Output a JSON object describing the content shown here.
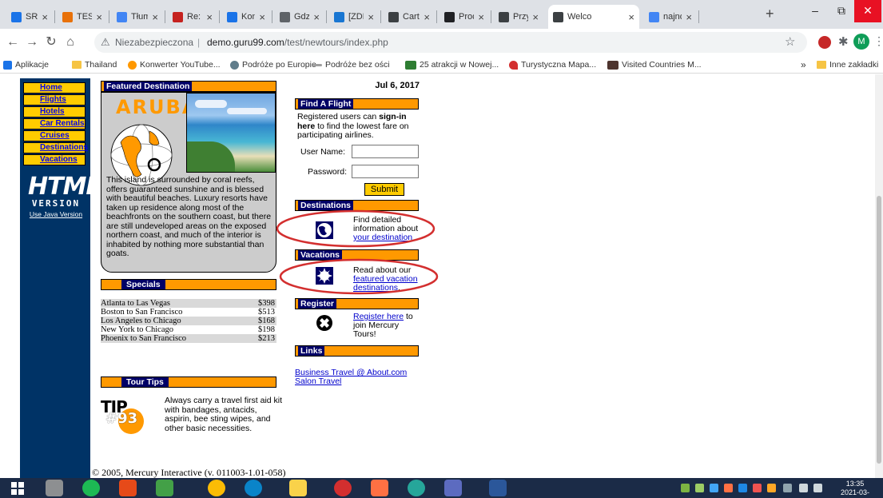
{
  "browser": {
    "tabs": [
      {
        "label": "SRS_w",
        "color": "#1a73e8"
      },
      {
        "label": "TEST F",
        "color": "#e8710a"
      },
      {
        "label": "Tłuma",
        "color": "#4285f4"
      },
      {
        "label": "Re: ZD",
        "color": "#c5221f"
      },
      {
        "label": "Konfe",
        "color": "#1a73e8"
      },
      {
        "label": "Gdzie",
        "color": "#5f6368"
      },
      {
        "label": "[ZDES",
        "color": "#1976d2"
      },
      {
        "label": "Cart It",
        "color": "#3c4043"
      },
      {
        "label": "Produ",
        "color": "#202124"
      },
      {
        "label": "Przykł",
        "color": "#3c4043"
      },
      {
        "label": "Welco",
        "color": "#3c4043"
      },
      {
        "label": "najnow",
        "color": "#4285f4"
      }
    ],
    "new_tab": "+",
    "url_security": "Niezabezpieczona",
    "url_separator": "|",
    "url_host": "demo.guru99.com",
    "url_path": "/test/newtours/index.php",
    "profile_initial": "M",
    "bookmarks": [
      {
        "label": "Aplikacje"
      },
      {
        "label": "Thailand"
      },
      {
        "label": "Konwerter YouTube..."
      },
      {
        "label": "Podróże po Europie"
      },
      {
        "label": "Podróże bez ości"
      },
      {
        "label": "25 atrakcji w Nowej..."
      },
      {
        "label": "Turystyczna Mapa..."
      },
      {
        "label": "Visited Countries M..."
      }
    ],
    "bookmarks_more": "»",
    "other_bookmarks": "Inne zakładki"
  },
  "page": {
    "nav": [
      "Home",
      "Flights",
      "Hotels",
      "Car Rentals",
      "Cruises",
      "Destinations",
      "Vacations"
    ],
    "html_logo_line1": "HTML",
    "html_logo_line2": "VERSION",
    "java_link": "Use Java Version",
    "featured": {
      "header": "Featured Destination",
      "title": "ARUBA",
      "text": "This island is surrounded by coral reefs, offers guaranteed sunshine and is blessed with beautiful beaches. Luxury resorts have taken up residence along most of the beachfronts on the southern coast, but there are still undeveloped areas on the exposed northern coast, and much of the interior is inhabited by nothing more substantial than goats."
    },
    "specials": {
      "header": "Specials",
      "rows": [
        {
          "route": "Atlanta to Las Vegas",
          "price": "$398"
        },
        {
          "route": "Boston to San Francisco",
          "price": "$513"
        },
        {
          "route": "Los Angeles to Chicago",
          "price": "$168"
        },
        {
          "route": "New York to Chicago",
          "price": "$198"
        },
        {
          "route": "Phoenix to San Francisco",
          "price": "$213"
        }
      ]
    },
    "tour_tips": {
      "header": "Tour Tips",
      "tip_word": "TIP",
      "tip_number": "#93",
      "text": "Always carry a travel first aid kit with bandages, antacids, aspirin, bee sting wipes, and other basic necessities."
    },
    "date": "Jul 6, 2017",
    "find_flight": {
      "header": "Find A Flight",
      "intro_pre": "Registered users can ",
      "intro_bold": "sign-in here",
      "intro_post": " to find the lowest fare on participating airlines.",
      "username_label": "User Name:",
      "password_label": "Password:",
      "submit": "Submit"
    },
    "destinations": {
      "header": "Destinations",
      "text": "Find detailed information about ",
      "link": "your destination"
    },
    "vacations": {
      "header": "Vacations",
      "text": "Read about our ",
      "link": "featured vacation destinations",
      "end": "."
    },
    "register": {
      "header": "Register",
      "link": "Register here",
      "text": " to join Mercury Tours!"
    },
    "links": {
      "header": "Links",
      "items": [
        "Business Travel @ About.com",
        "Salon Travel"
      ]
    },
    "footer": "© 2005, Mercury Interactive (v. 011003-1.01-058)"
  },
  "taskbar": {
    "time": "13:35",
    "date": "2021-03-04"
  },
  "colors": {
    "sidebar_bg": "#003366",
    "nav_bg": "#ffcc00",
    "header_bg": "#ff9900",
    "header_label_bg": "#000066",
    "annotation_red": "#d32f2f"
  }
}
